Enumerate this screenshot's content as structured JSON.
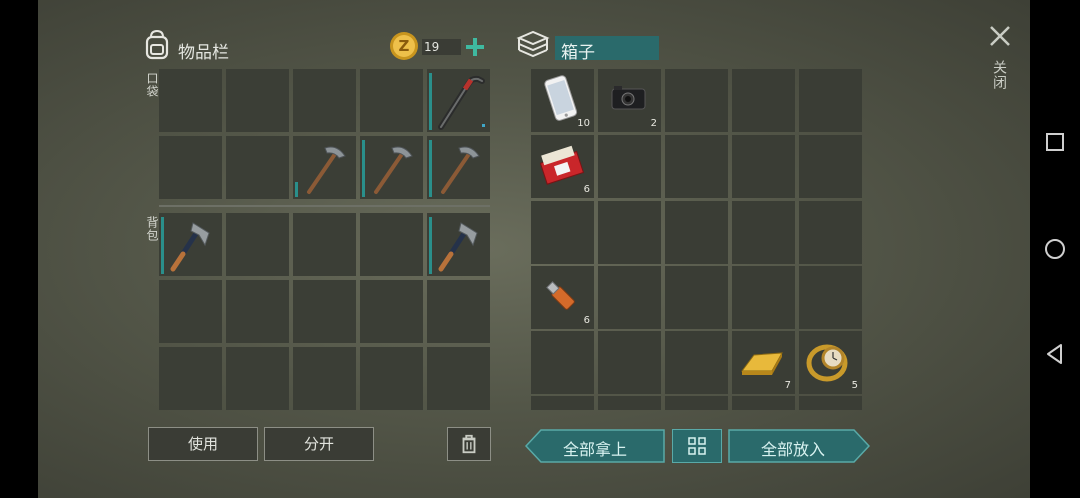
{
  "inventory": {
    "title": "物品栏",
    "coins": "19",
    "pocket_label": "口袋",
    "backpack_label": "背包",
    "use_button": "使用",
    "split_button": "分开"
  },
  "box": {
    "title": "箱子",
    "items": {
      "phone_count": "10",
      "camera_count": "2",
      "cigarettes_count": "6",
      "usb_count": "6",
      "gold_count": "7",
      "watch_count": "5"
    },
    "take_all_button": "全部拿上",
    "put_all_button": "全部放入"
  },
  "close_label": "关闭",
  "colors": {
    "accent_teal": "#2a6a6b",
    "coin_gold": "#e2b33a",
    "plus_green": "#3fb9a0"
  },
  "icons": [
    "backpack-icon",
    "coin-icon",
    "plus-icon",
    "box-stack-icon",
    "close-icon",
    "trash-icon",
    "grid-icon",
    "crowbar-icon",
    "pickaxe-icon",
    "hatchet-icon",
    "phone-icon",
    "camera-icon",
    "cigarettes-icon",
    "usb-icon",
    "gold-bar-icon",
    "watch-icon"
  ]
}
